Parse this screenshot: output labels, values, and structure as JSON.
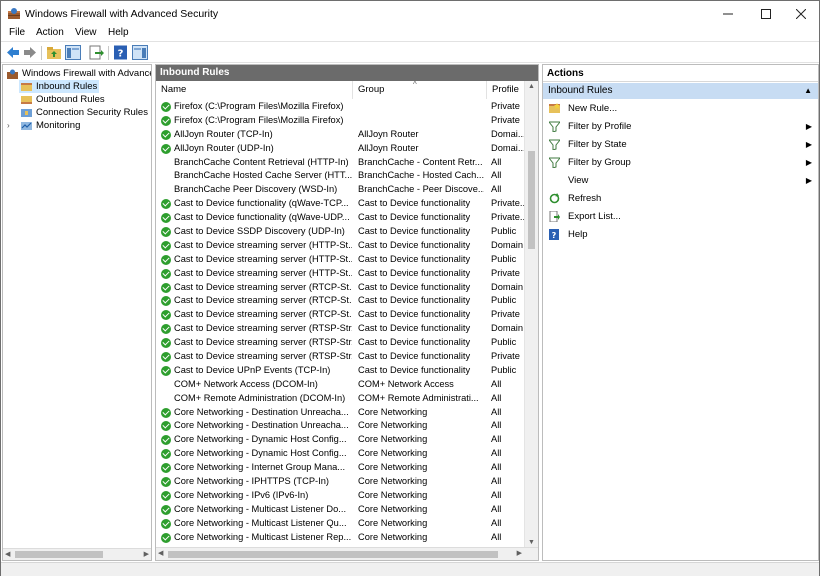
{
  "window": {
    "title": "Windows Firewall with Advanced Security"
  },
  "menu": {
    "items": [
      "File",
      "Action",
      "View",
      "Help"
    ]
  },
  "tree": {
    "root": "Windows Firewall with Advance",
    "items": [
      {
        "label": "Inbound Rules",
        "selected": true
      },
      {
        "label": "Outbound Rules",
        "selected": false
      },
      {
        "label": "Connection Security Rules",
        "selected": false
      },
      {
        "label": "Monitoring",
        "selected": false
      }
    ]
  },
  "center": {
    "header": "Inbound Rules",
    "columns": {
      "name": "Name",
      "group": "Group",
      "profile": "Profile"
    },
    "rows": [
      {
        "enabled": true,
        "name": "Firefox (C:\\Program Files\\Mozilla Firefox)",
        "group": "",
        "profile": "Private"
      },
      {
        "enabled": true,
        "name": "Firefox (C:\\Program Files\\Mozilla Firefox)",
        "group": "",
        "profile": "Private"
      },
      {
        "enabled": true,
        "name": "AllJoyn Router (TCP-In)",
        "group": "AllJoyn Router",
        "profile": "Domai..."
      },
      {
        "enabled": true,
        "name": "AllJoyn Router (UDP-In)",
        "group": "AllJoyn Router",
        "profile": "Domai..."
      },
      {
        "enabled": false,
        "name": "BranchCache Content Retrieval (HTTP-In)",
        "group": "BranchCache - Content Retr...",
        "profile": "All"
      },
      {
        "enabled": false,
        "name": "BranchCache Hosted Cache Server (HTT...",
        "group": "BranchCache - Hosted Cach...",
        "profile": "All"
      },
      {
        "enabled": false,
        "name": "BranchCache Peer Discovery (WSD-In)",
        "group": "BranchCache - Peer Discove...",
        "profile": "All"
      },
      {
        "enabled": true,
        "name": "Cast to Device functionality (qWave-TCP...",
        "group": "Cast to Device functionality",
        "profile": "Private..."
      },
      {
        "enabled": true,
        "name": "Cast to Device functionality (qWave-UDP...",
        "group": "Cast to Device functionality",
        "profile": "Private..."
      },
      {
        "enabled": true,
        "name": "Cast to Device SSDP Discovery (UDP-In)",
        "group": "Cast to Device functionality",
        "profile": "Public"
      },
      {
        "enabled": true,
        "name": "Cast to Device streaming server (HTTP-St...",
        "group": "Cast to Device functionality",
        "profile": "Domain"
      },
      {
        "enabled": true,
        "name": "Cast to Device streaming server (HTTP-St...",
        "group": "Cast to Device functionality",
        "profile": "Public"
      },
      {
        "enabled": true,
        "name": "Cast to Device streaming server (HTTP-St...",
        "group": "Cast to Device functionality",
        "profile": "Private"
      },
      {
        "enabled": true,
        "name": "Cast to Device streaming server (RTCP-St...",
        "group": "Cast to Device functionality",
        "profile": "Domain"
      },
      {
        "enabled": true,
        "name": "Cast to Device streaming server (RTCP-St...",
        "group": "Cast to Device functionality",
        "profile": "Public"
      },
      {
        "enabled": true,
        "name": "Cast to Device streaming server (RTCP-St...",
        "group": "Cast to Device functionality",
        "profile": "Private"
      },
      {
        "enabled": true,
        "name": "Cast to Device streaming server (RTSP-Str...",
        "group": "Cast to Device functionality",
        "profile": "Domain"
      },
      {
        "enabled": true,
        "name": "Cast to Device streaming server (RTSP-Str...",
        "group": "Cast to Device functionality",
        "profile": "Public"
      },
      {
        "enabled": true,
        "name": "Cast to Device streaming server (RTSP-Str...",
        "group": "Cast to Device functionality",
        "profile": "Private"
      },
      {
        "enabled": true,
        "name": "Cast to Device UPnP Events (TCP-In)",
        "group": "Cast to Device functionality",
        "profile": "Public"
      },
      {
        "enabled": false,
        "name": "COM+ Network Access (DCOM-In)",
        "group": "COM+ Network Access",
        "profile": "All"
      },
      {
        "enabled": false,
        "name": "COM+ Remote Administration (DCOM-In)",
        "group": "COM+ Remote Administrati...",
        "profile": "All"
      },
      {
        "enabled": true,
        "name": "Core Networking - Destination Unreacha...",
        "group": "Core Networking",
        "profile": "All"
      },
      {
        "enabled": true,
        "name": "Core Networking - Destination Unreacha...",
        "group": "Core Networking",
        "profile": "All"
      },
      {
        "enabled": true,
        "name": "Core Networking - Dynamic Host Config...",
        "group": "Core Networking",
        "profile": "All"
      },
      {
        "enabled": true,
        "name": "Core Networking - Dynamic Host Config...",
        "group": "Core Networking",
        "profile": "All"
      },
      {
        "enabled": true,
        "name": "Core Networking - Internet Group Mana...",
        "group": "Core Networking",
        "profile": "All"
      },
      {
        "enabled": true,
        "name": "Core Networking - IPHTTPS (TCP-In)",
        "group": "Core Networking",
        "profile": "All"
      },
      {
        "enabled": true,
        "name": "Core Networking - IPv6 (IPv6-In)",
        "group": "Core Networking",
        "profile": "All"
      },
      {
        "enabled": true,
        "name": "Core Networking - Multicast Listener Do...",
        "group": "Core Networking",
        "profile": "All"
      },
      {
        "enabled": true,
        "name": "Core Networking - Multicast Listener Qu...",
        "group": "Core Networking",
        "profile": "All"
      },
      {
        "enabled": true,
        "name": "Core Networking - Multicast Listener Rep...",
        "group": "Core Networking",
        "profile": "All"
      }
    ]
  },
  "actions": {
    "header": "Actions",
    "section": "Inbound Rules",
    "items": [
      {
        "label": "New Rule...",
        "icon": "new-rule-icon",
        "submenu": false
      },
      {
        "label": "Filter by Profile",
        "icon": "filter-icon",
        "submenu": true
      },
      {
        "label": "Filter by State",
        "icon": "filter-icon",
        "submenu": true
      },
      {
        "label": "Filter by Group",
        "icon": "filter-icon",
        "submenu": true
      },
      {
        "label": "View",
        "icon": "",
        "submenu": true
      },
      {
        "label": "Refresh",
        "icon": "refresh-icon",
        "submenu": false
      },
      {
        "label": "Export List...",
        "icon": "export-icon",
        "submenu": false
      },
      {
        "label": "Help",
        "icon": "help-icon",
        "submenu": false
      }
    ]
  },
  "colors": {
    "selection": "#cde8ff",
    "section_header": "#c7dcf3",
    "pane_header": "#6b6b6b",
    "enabled_check": "#2e9e2e"
  }
}
